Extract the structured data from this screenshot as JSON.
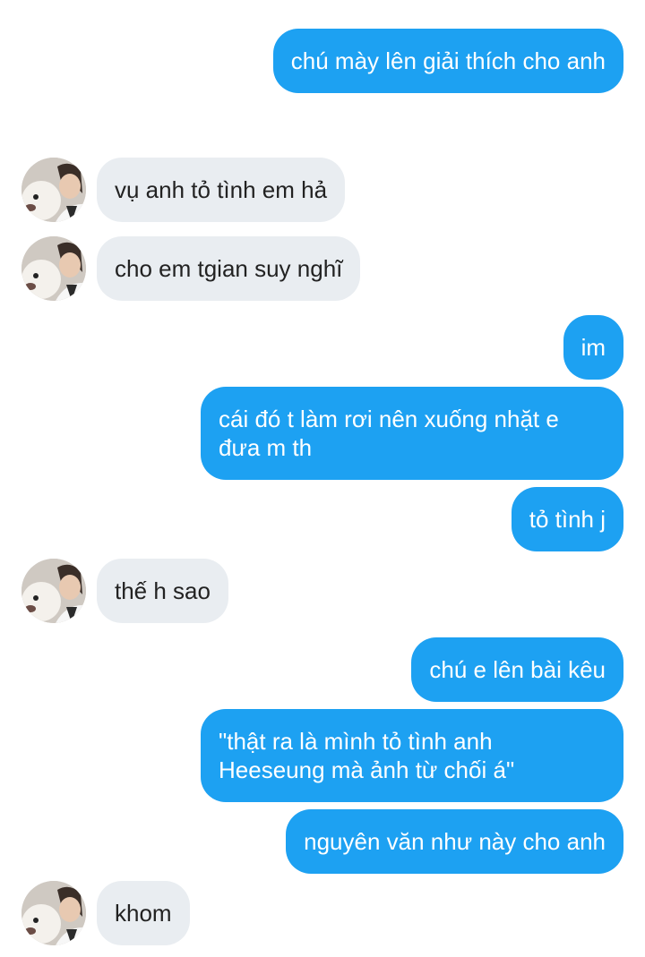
{
  "messages": [
    {
      "from": "me",
      "text": "chú mày lên giải thích cho anh"
    },
    {
      "from": "them",
      "text": "vụ anh tỏ tình em hả"
    },
    {
      "from": "them",
      "text": "cho em tgian suy nghĩ"
    },
    {
      "from": "me",
      "text": "im"
    },
    {
      "from": "me",
      "text": "cái đó t làm rơi nên xuống nhặt e\nđưa m th"
    },
    {
      "from": "me",
      "text": "tỏ tình j"
    },
    {
      "from": "them",
      "text": "thế h sao"
    },
    {
      "from": "me",
      "text": "chú e lên bài kêu"
    },
    {
      "from": "me",
      "text": "\"thật ra là mình tỏ tình anh\nHeeseung mà ảnh từ chối á\""
    },
    {
      "from": "me",
      "text": "nguyên văn như này cho anh"
    },
    {
      "from": "them",
      "text": "khom"
    }
  ],
  "colors": {
    "me_bubble": "#1da1f2",
    "them_bubble": "#e9edf1"
  },
  "avatar_icon": "avatar-person-with-dog"
}
